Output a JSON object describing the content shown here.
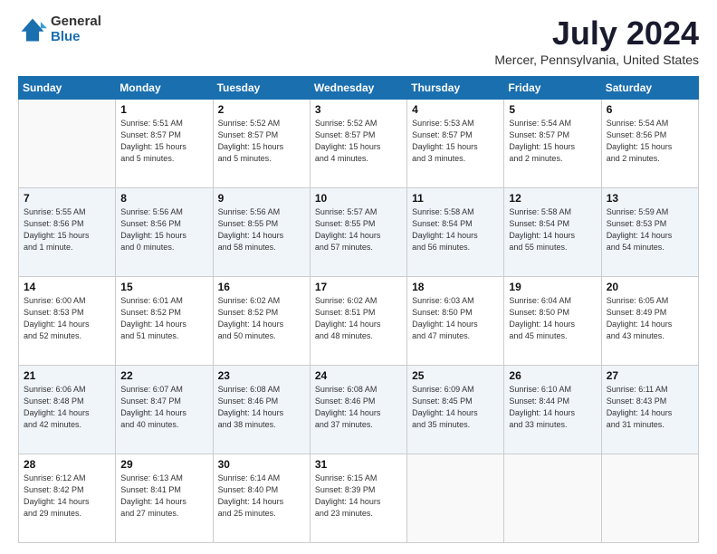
{
  "header": {
    "logo_general": "General",
    "logo_blue": "Blue",
    "title": "July 2024",
    "subtitle": "Mercer, Pennsylvania, United States"
  },
  "days_of_week": [
    "Sunday",
    "Monday",
    "Tuesday",
    "Wednesday",
    "Thursday",
    "Friday",
    "Saturday"
  ],
  "weeks": [
    [
      {
        "day": "",
        "info": ""
      },
      {
        "day": "1",
        "info": "Sunrise: 5:51 AM\nSunset: 8:57 PM\nDaylight: 15 hours\nand 5 minutes."
      },
      {
        "day": "2",
        "info": "Sunrise: 5:52 AM\nSunset: 8:57 PM\nDaylight: 15 hours\nand 5 minutes."
      },
      {
        "day": "3",
        "info": "Sunrise: 5:52 AM\nSunset: 8:57 PM\nDaylight: 15 hours\nand 4 minutes."
      },
      {
        "day": "4",
        "info": "Sunrise: 5:53 AM\nSunset: 8:57 PM\nDaylight: 15 hours\nand 3 minutes."
      },
      {
        "day": "5",
        "info": "Sunrise: 5:54 AM\nSunset: 8:57 PM\nDaylight: 15 hours\nand 2 minutes."
      },
      {
        "day": "6",
        "info": "Sunrise: 5:54 AM\nSunset: 8:56 PM\nDaylight: 15 hours\nand 2 minutes."
      }
    ],
    [
      {
        "day": "7",
        "info": "Sunrise: 5:55 AM\nSunset: 8:56 PM\nDaylight: 15 hours\nand 1 minute."
      },
      {
        "day": "8",
        "info": "Sunrise: 5:56 AM\nSunset: 8:56 PM\nDaylight: 15 hours\nand 0 minutes."
      },
      {
        "day": "9",
        "info": "Sunrise: 5:56 AM\nSunset: 8:55 PM\nDaylight: 14 hours\nand 58 minutes."
      },
      {
        "day": "10",
        "info": "Sunrise: 5:57 AM\nSunset: 8:55 PM\nDaylight: 14 hours\nand 57 minutes."
      },
      {
        "day": "11",
        "info": "Sunrise: 5:58 AM\nSunset: 8:54 PM\nDaylight: 14 hours\nand 56 minutes."
      },
      {
        "day": "12",
        "info": "Sunrise: 5:58 AM\nSunset: 8:54 PM\nDaylight: 14 hours\nand 55 minutes."
      },
      {
        "day": "13",
        "info": "Sunrise: 5:59 AM\nSunset: 8:53 PM\nDaylight: 14 hours\nand 54 minutes."
      }
    ],
    [
      {
        "day": "14",
        "info": "Sunrise: 6:00 AM\nSunset: 8:53 PM\nDaylight: 14 hours\nand 52 minutes."
      },
      {
        "day": "15",
        "info": "Sunrise: 6:01 AM\nSunset: 8:52 PM\nDaylight: 14 hours\nand 51 minutes."
      },
      {
        "day": "16",
        "info": "Sunrise: 6:02 AM\nSunset: 8:52 PM\nDaylight: 14 hours\nand 50 minutes."
      },
      {
        "day": "17",
        "info": "Sunrise: 6:02 AM\nSunset: 8:51 PM\nDaylight: 14 hours\nand 48 minutes."
      },
      {
        "day": "18",
        "info": "Sunrise: 6:03 AM\nSunset: 8:50 PM\nDaylight: 14 hours\nand 47 minutes."
      },
      {
        "day": "19",
        "info": "Sunrise: 6:04 AM\nSunset: 8:50 PM\nDaylight: 14 hours\nand 45 minutes."
      },
      {
        "day": "20",
        "info": "Sunrise: 6:05 AM\nSunset: 8:49 PM\nDaylight: 14 hours\nand 43 minutes."
      }
    ],
    [
      {
        "day": "21",
        "info": "Sunrise: 6:06 AM\nSunset: 8:48 PM\nDaylight: 14 hours\nand 42 minutes."
      },
      {
        "day": "22",
        "info": "Sunrise: 6:07 AM\nSunset: 8:47 PM\nDaylight: 14 hours\nand 40 minutes."
      },
      {
        "day": "23",
        "info": "Sunrise: 6:08 AM\nSunset: 8:46 PM\nDaylight: 14 hours\nand 38 minutes."
      },
      {
        "day": "24",
        "info": "Sunrise: 6:08 AM\nSunset: 8:46 PM\nDaylight: 14 hours\nand 37 minutes."
      },
      {
        "day": "25",
        "info": "Sunrise: 6:09 AM\nSunset: 8:45 PM\nDaylight: 14 hours\nand 35 minutes."
      },
      {
        "day": "26",
        "info": "Sunrise: 6:10 AM\nSunset: 8:44 PM\nDaylight: 14 hours\nand 33 minutes."
      },
      {
        "day": "27",
        "info": "Sunrise: 6:11 AM\nSunset: 8:43 PM\nDaylight: 14 hours\nand 31 minutes."
      }
    ],
    [
      {
        "day": "28",
        "info": "Sunrise: 6:12 AM\nSunset: 8:42 PM\nDaylight: 14 hours\nand 29 minutes."
      },
      {
        "day": "29",
        "info": "Sunrise: 6:13 AM\nSunset: 8:41 PM\nDaylight: 14 hours\nand 27 minutes."
      },
      {
        "day": "30",
        "info": "Sunrise: 6:14 AM\nSunset: 8:40 PM\nDaylight: 14 hours\nand 25 minutes."
      },
      {
        "day": "31",
        "info": "Sunrise: 6:15 AM\nSunset: 8:39 PM\nDaylight: 14 hours\nand 23 minutes."
      },
      {
        "day": "",
        "info": ""
      },
      {
        "day": "",
        "info": ""
      },
      {
        "day": "",
        "info": ""
      }
    ]
  ]
}
